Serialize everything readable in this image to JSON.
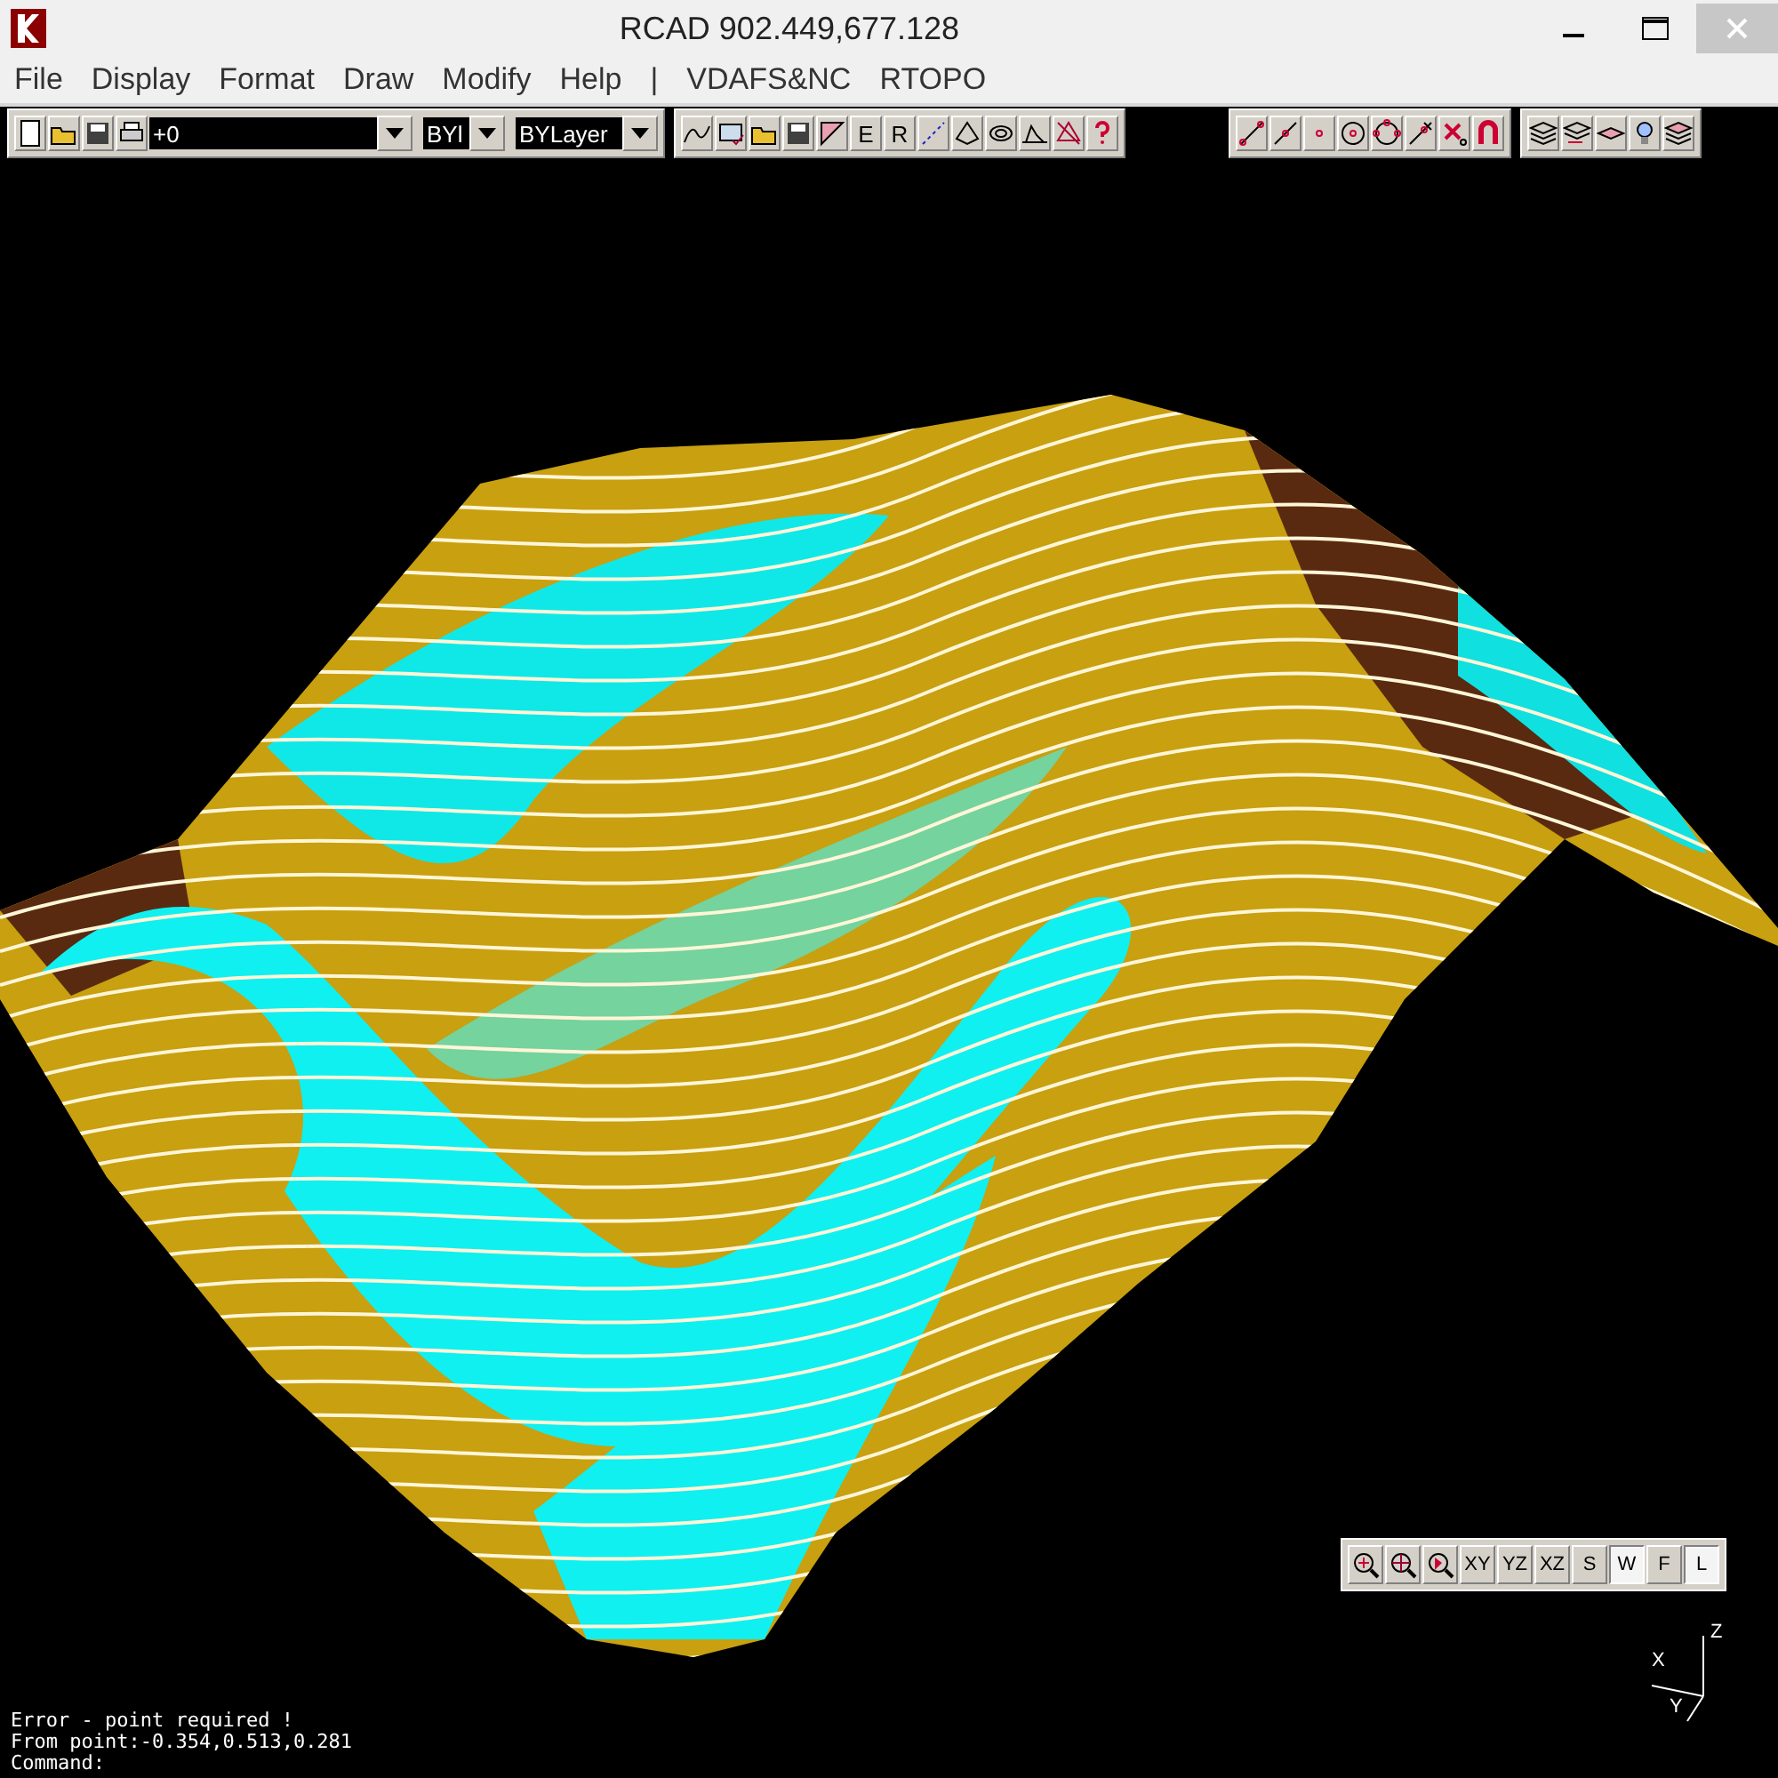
{
  "window": {
    "title": "RCAD  902.449,677.128"
  },
  "menu": [
    "File",
    "Display",
    "Format",
    "Draw",
    "Modify",
    "Help",
    "|",
    "VDAFS&NC",
    "RTOPO"
  ],
  "layer_toolbar": {
    "layer": "+0",
    "color_field": "BYl",
    "linetype": "BYLayer"
  },
  "draw_toolbar": [
    {
      "kind": "icon"
    },
    {
      "kind": "icon"
    },
    {
      "kind": "icon"
    },
    {
      "kind": "icon"
    },
    {
      "kind": "icon"
    },
    {
      "kind": "letter",
      "label": "E"
    },
    {
      "kind": "letter",
      "label": "R"
    },
    {
      "kind": "icon"
    },
    {
      "kind": "icon"
    },
    {
      "kind": "icon"
    },
    {
      "kind": "icon"
    },
    {
      "kind": "icon"
    },
    {
      "kind": "icon"
    }
  ],
  "snap_toolbar": [
    {
      "kind": "icon"
    },
    {
      "kind": "icon"
    },
    {
      "kind": "icon"
    },
    {
      "kind": "icon"
    },
    {
      "kind": "icon"
    },
    {
      "kind": "icon"
    },
    {
      "kind": "icon"
    },
    {
      "kind": "icon"
    }
  ],
  "view_toolbar": [
    {
      "kind": "icon",
      "selected": false
    },
    {
      "kind": "icon",
      "selected": false
    },
    {
      "kind": "icon",
      "selected": false
    },
    {
      "kind": "text",
      "label": "XY",
      "selected": false
    },
    {
      "kind": "text",
      "label": "YZ",
      "selected": false
    },
    {
      "kind": "text",
      "label": "XZ",
      "selected": false
    },
    {
      "kind": "text",
      "label": "S",
      "selected": false
    },
    {
      "kind": "text",
      "label": "W",
      "selected": true
    },
    {
      "kind": "text",
      "label": "F",
      "selected": false
    },
    {
      "kind": "text",
      "label": "L",
      "selected": true
    }
  ],
  "axes": {
    "x": "X",
    "y": "Y",
    "z": "Z"
  },
  "command_log": [
    "Error - point required !",
    "From point:-0.354,0.513,0.281",
    "Command:"
  ]
}
